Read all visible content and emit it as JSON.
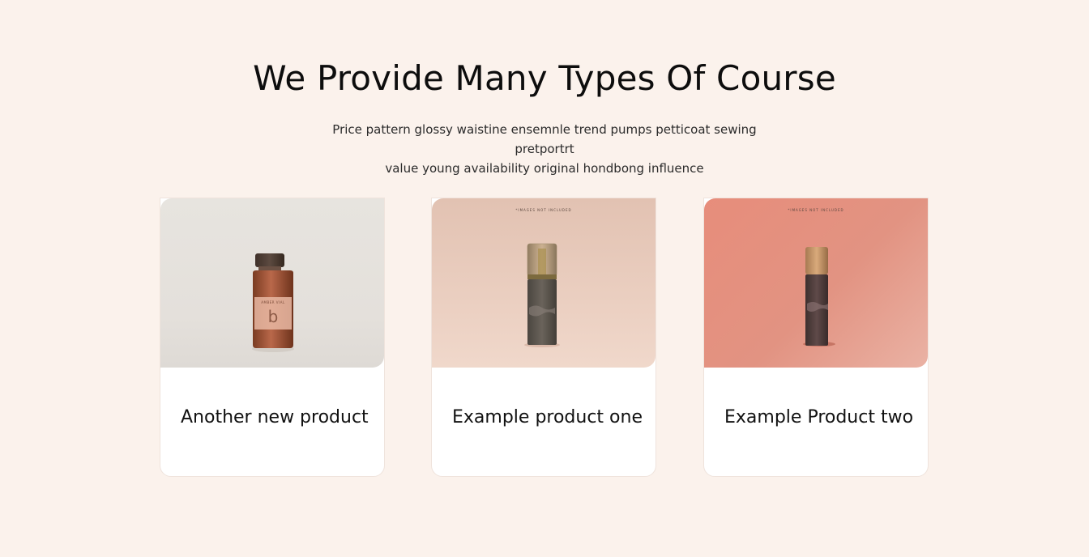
{
  "section": {
    "title": "We Provide Many Types Of Course",
    "subtitle_lines": [
      "Price pattern glossy waistine ensemnle trend pumps petticoat sewing pretportrt",
      "value young availability original hondbong influence"
    ]
  },
  "cards": [
    {
      "title": "Another new product",
      "image_label": "AMBER VIAL",
      "image_letter": "b"
    },
    {
      "title": "Example product one",
      "image_caption": "*IMAGES NOT INCLUDED"
    },
    {
      "title": "Example Product two",
      "image_caption": "*IMAGES NOT INCLUDED"
    }
  ],
  "colors": {
    "background": "#fbf2ec",
    "card": "#ffffff",
    "text": "#111111"
  }
}
